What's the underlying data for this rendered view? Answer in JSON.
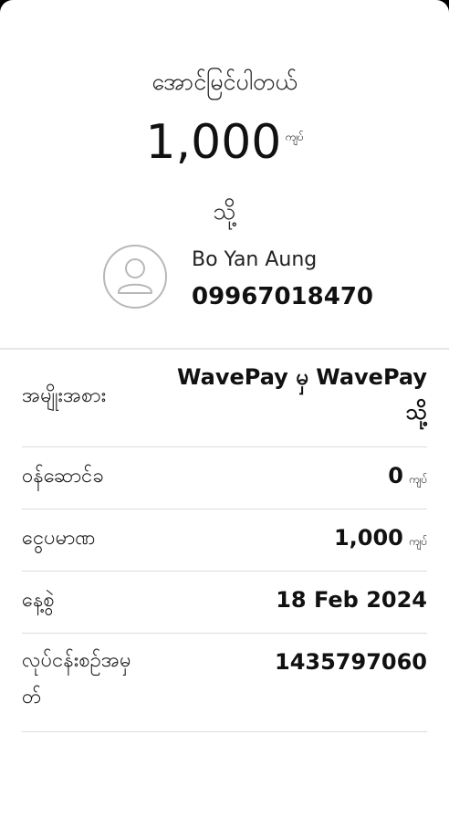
{
  "receipt": {
    "title": "အောင်မြင်ပါတယ်",
    "amount": "1,000",
    "currency": "ကျပ်",
    "to_label": "သို့",
    "receiver_name": "Bo Yan Aung",
    "receiver_phone": "09967018470"
  },
  "details": {
    "type_label": "အမျိုးအစား",
    "type_value_line1": "WavePay မှ WavePay",
    "type_value_line2": "သို့",
    "fee_label": "ဝန်ဆောင်ခ",
    "fee_value": "0",
    "fee_unit": "ကျပ်",
    "amount_label": "ငွေပမာဏ",
    "amount_value": "1,000",
    "amount_unit": "ကျပ်",
    "date_label": "နေ့စွဲ",
    "date_value": "18 Feb 2024",
    "txn_label_line1": "လုပ်ငန်းစဉ်အမှ",
    "txn_label_line2": "တ်",
    "txn_value": "1435797060"
  },
  "icons": {
    "avatar": "user-avatar-icon"
  }
}
